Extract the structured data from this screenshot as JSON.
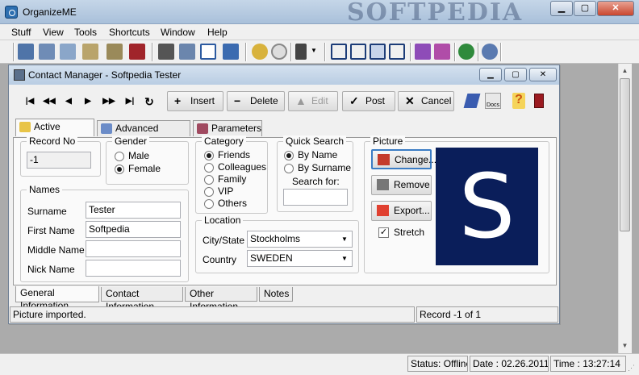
{
  "app": {
    "title": "OrganizeME",
    "watermark": "SOFTPEDIA"
  },
  "menu": [
    "Stuff",
    "View",
    "Tools",
    "Shortcuts",
    "Window",
    "Help"
  ],
  "child": {
    "title": "Contact Manager - Softpedia Tester",
    "actions": {
      "insert": "Insert",
      "delete": "Delete",
      "edit": "Edit",
      "post": "Post",
      "cancel": "Cancel"
    },
    "tabs": {
      "active": "Active Record",
      "advanced": "Advanced Search",
      "parameters": "Parameters"
    },
    "record_no": {
      "caption": "Record No",
      "value": "-1"
    },
    "gender": {
      "caption": "Gender",
      "male": "Male",
      "female": "Female",
      "selected": "Female"
    },
    "category": {
      "caption": "Category",
      "options": [
        "Friends",
        "Colleagues",
        "Family",
        "VIP",
        "Others"
      ],
      "selected": "Friends"
    },
    "quick_search": {
      "caption": "Quick Search",
      "by_name": "By Name",
      "by_surname": "By Surname",
      "search_for": "Search for:",
      "value": "",
      "selected": "By Name"
    },
    "picture": {
      "caption": "Picture",
      "change": "Change...",
      "remove": "Remove",
      "export": "Export...",
      "stretch": "Stretch",
      "stretch_checked": true,
      "image_letter": "S",
      "bg_color": "#0a1e5a"
    },
    "names": {
      "caption": "Names",
      "surname_label": "Surname",
      "surname": "Tester",
      "first_label": "First Name",
      "first": "Softpedia",
      "middle_label": "Middle Name",
      "middle": "",
      "nick_label": "Nick Name",
      "nick": ""
    },
    "location": {
      "caption": "Location",
      "city_label": "City/State",
      "city": "Stockholms",
      "country_label": "Country",
      "country": "SWEDEN"
    },
    "bottom_tabs": [
      "General Information",
      "Contact Information",
      "Other Information",
      "Notes"
    ],
    "status": {
      "message": "Picture imported.",
      "record": "Record -1 of 1"
    }
  },
  "statusbar": {
    "status": "Status: Offline",
    "date": "Date : 02.26.2011",
    "time": "Time : 13:27:14"
  }
}
